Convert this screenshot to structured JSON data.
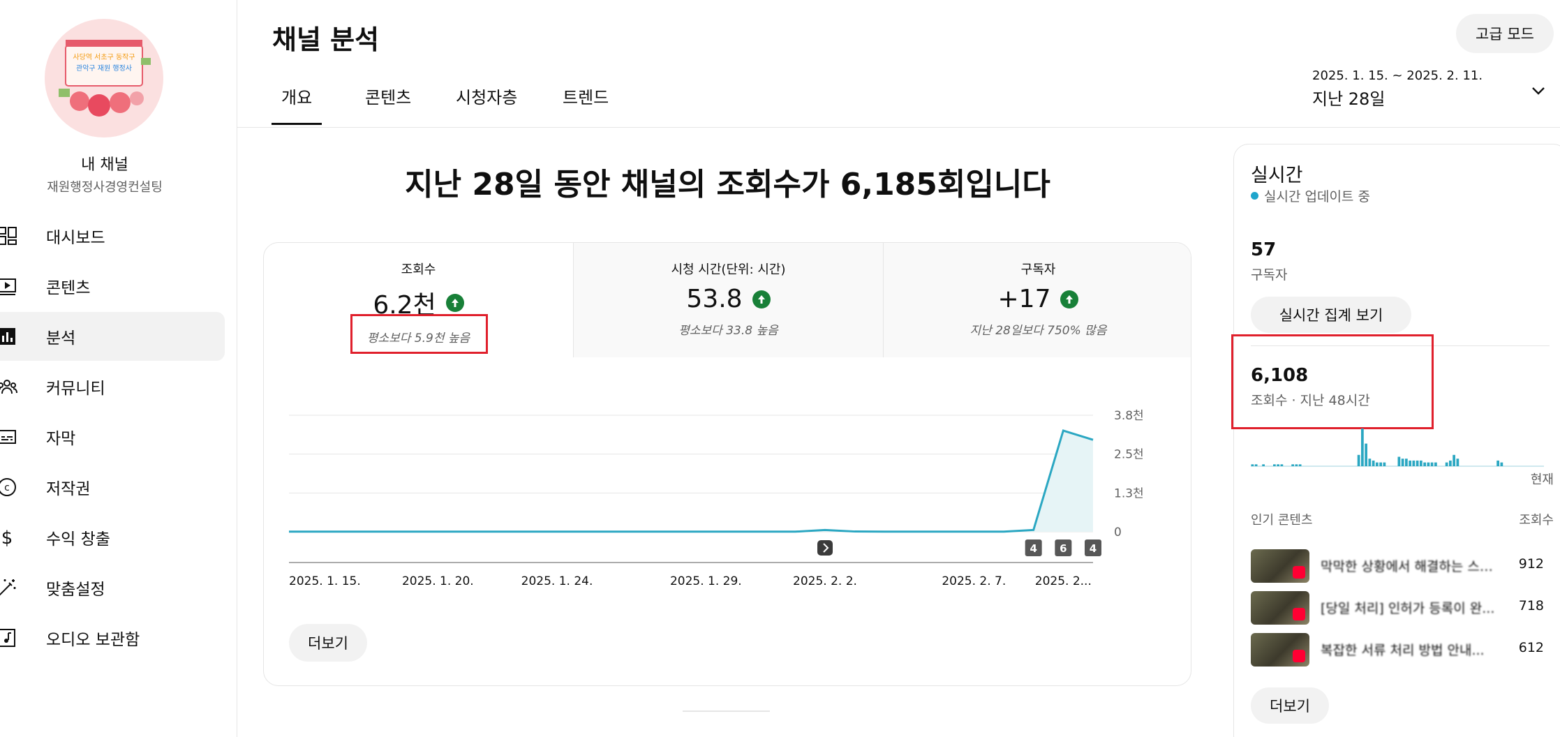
{
  "sidebar": {
    "channel_name": "내 채널",
    "channel_handle": "재원행정사경영컨설팅",
    "avatar_text": "사당역 서초구 동작구 관악구 재원 행정사",
    "items": [
      {
        "label": "대시보드",
        "icon": "dashboard-icon"
      },
      {
        "label": "콘텐츠",
        "icon": "content-icon"
      },
      {
        "label": "분석",
        "icon": "analytics-icon",
        "active": true
      },
      {
        "label": "커뮤니티",
        "icon": "community-icon"
      },
      {
        "label": "자막",
        "icon": "subtitles-icon"
      },
      {
        "label": "저작권",
        "icon": "copyright-icon"
      },
      {
        "label": "수익 창출",
        "icon": "dollar-icon"
      },
      {
        "label": "맞춤설정",
        "icon": "wand-icon"
      },
      {
        "label": "오디오 보관함",
        "icon": "audio-library-icon"
      }
    ]
  },
  "header": {
    "title": "채널 분석",
    "advanced_mode": "고급 모드",
    "tabs": [
      "개요",
      "콘텐츠",
      "시청자층",
      "트렌드"
    ],
    "active_tab": "개요",
    "date_range": "2025. 1. 15. ~ 2025. 2. 11.",
    "date_period": "지난 28일"
  },
  "main": {
    "headline": "지난 28일 동안 채널의 조회수가 6,185회입니다",
    "kpis": [
      {
        "label": "조회수",
        "value": "6.2천",
        "note": "평소보다 5.9천 높음"
      },
      {
        "label": "시청 시간(단위: 시간)",
        "value": "53.8",
        "note": "평소보다 33.8 높음"
      },
      {
        "label": "구독자",
        "value": "+17",
        "note": "지난 28일보다 750% 많음"
      }
    ],
    "more_label": "더보기"
  },
  "chart_data": {
    "type": "area",
    "x": [
      "2025. 1. 15.",
      "2025. 1. 16.",
      "2025. 1. 17.",
      "2025. 1. 18.",
      "2025. 1. 19.",
      "2025. 1. 20.",
      "2025. 1. 21.",
      "2025. 1. 22.",
      "2025. 1. 23.",
      "2025. 1. 24.",
      "2025. 1. 25.",
      "2025. 1. 26.",
      "2025. 1. 27.",
      "2025. 1. 28.",
      "2025. 1. 29.",
      "2025. 1. 30.",
      "2025. 1. 31.",
      "2025. 2. 1.",
      "2025. 2. 2.",
      "2025. 2. 3.",
      "2025. 2. 4.",
      "2025. 2. 5.",
      "2025. 2. 6.",
      "2025. 2. 7.",
      "2025. 2. 8.",
      "2025. 2. 9.",
      "2025. 2. 10.",
      "2025. 2. 11."
    ],
    "values": [
      5,
      5,
      5,
      5,
      5,
      5,
      5,
      5,
      5,
      5,
      5,
      5,
      5,
      5,
      5,
      5,
      5,
      5,
      60,
      10,
      5,
      5,
      5,
      5,
      5,
      60,
      3300,
      3000
    ],
    "xtick_labels": [
      "2025. 1. 15.",
      "2025. 1. 20.",
      "2025. 1. 24.",
      "2025. 1. 29.",
      "2025. 2. 2.",
      "2025. 2. 7.",
      "2025. 2..."
    ],
    "ytick_labels": [
      "3.8천",
      "2.5천",
      "1.3천",
      "0"
    ],
    "ylim": [
      0,
      3800
    ],
    "markers": [
      {
        "date": "2025. 2. 2.",
        "kind": "shorts-icon"
      },
      {
        "date": "2025. 2. 9.",
        "label": "4"
      },
      {
        "date": "2025. 2. 10.",
        "label": "6"
      },
      {
        "date": "2025. 2. 11.",
        "label": "4"
      }
    ],
    "line_color": "#2ba7c2",
    "fill_color": "#e6f4f6",
    "grid": true
  },
  "realtime": {
    "title": "실시간",
    "status": "실시간 업데이트 중",
    "subscribers": "57",
    "subscribers_label": "구독자",
    "button": "실시간 집계 보기",
    "views": "6,108",
    "views_label": "조회수 · 지난 48시간",
    "now_label": "현재",
    "top_label": "인기 콘텐츠",
    "top_col": "조회수",
    "bars": [
      1,
      1,
      0,
      1,
      0,
      0,
      1,
      1,
      1,
      0,
      0,
      1,
      1,
      1,
      0,
      0,
      0,
      0,
      0,
      0,
      0,
      0,
      0,
      0,
      0,
      0,
      0,
      0,
      0,
      6,
      20,
      12,
      4,
      3,
      2,
      2,
      2,
      0,
      0,
      0,
      5,
      4,
      4,
      3,
      3,
      3,
      3,
      2,
      2,
      2,
      2,
      0,
      0,
      2,
      3,
      6,
      4,
      0,
      0,
      0,
      0,
      0,
      0,
      0,
      0,
      0,
      0,
      3,
      2,
      0,
      0,
      0,
      0,
      0,
      0,
      0,
      0,
      0,
      0,
      0
    ],
    "items": [
      {
        "title": "막막한 상황에서 해결하는 스텍...",
        "views": "912"
      },
      {
        "title": "[당일 처리] 인허가 등록이 완...",
        "views": "718"
      },
      {
        "title": "복잡한 서류 처리 방법 안내...",
        "views": "612"
      }
    ],
    "more_label": "더보기"
  },
  "colors": {
    "accent": "#2ba7c2",
    "up": "#188038",
    "highlight": "#e0202c"
  }
}
